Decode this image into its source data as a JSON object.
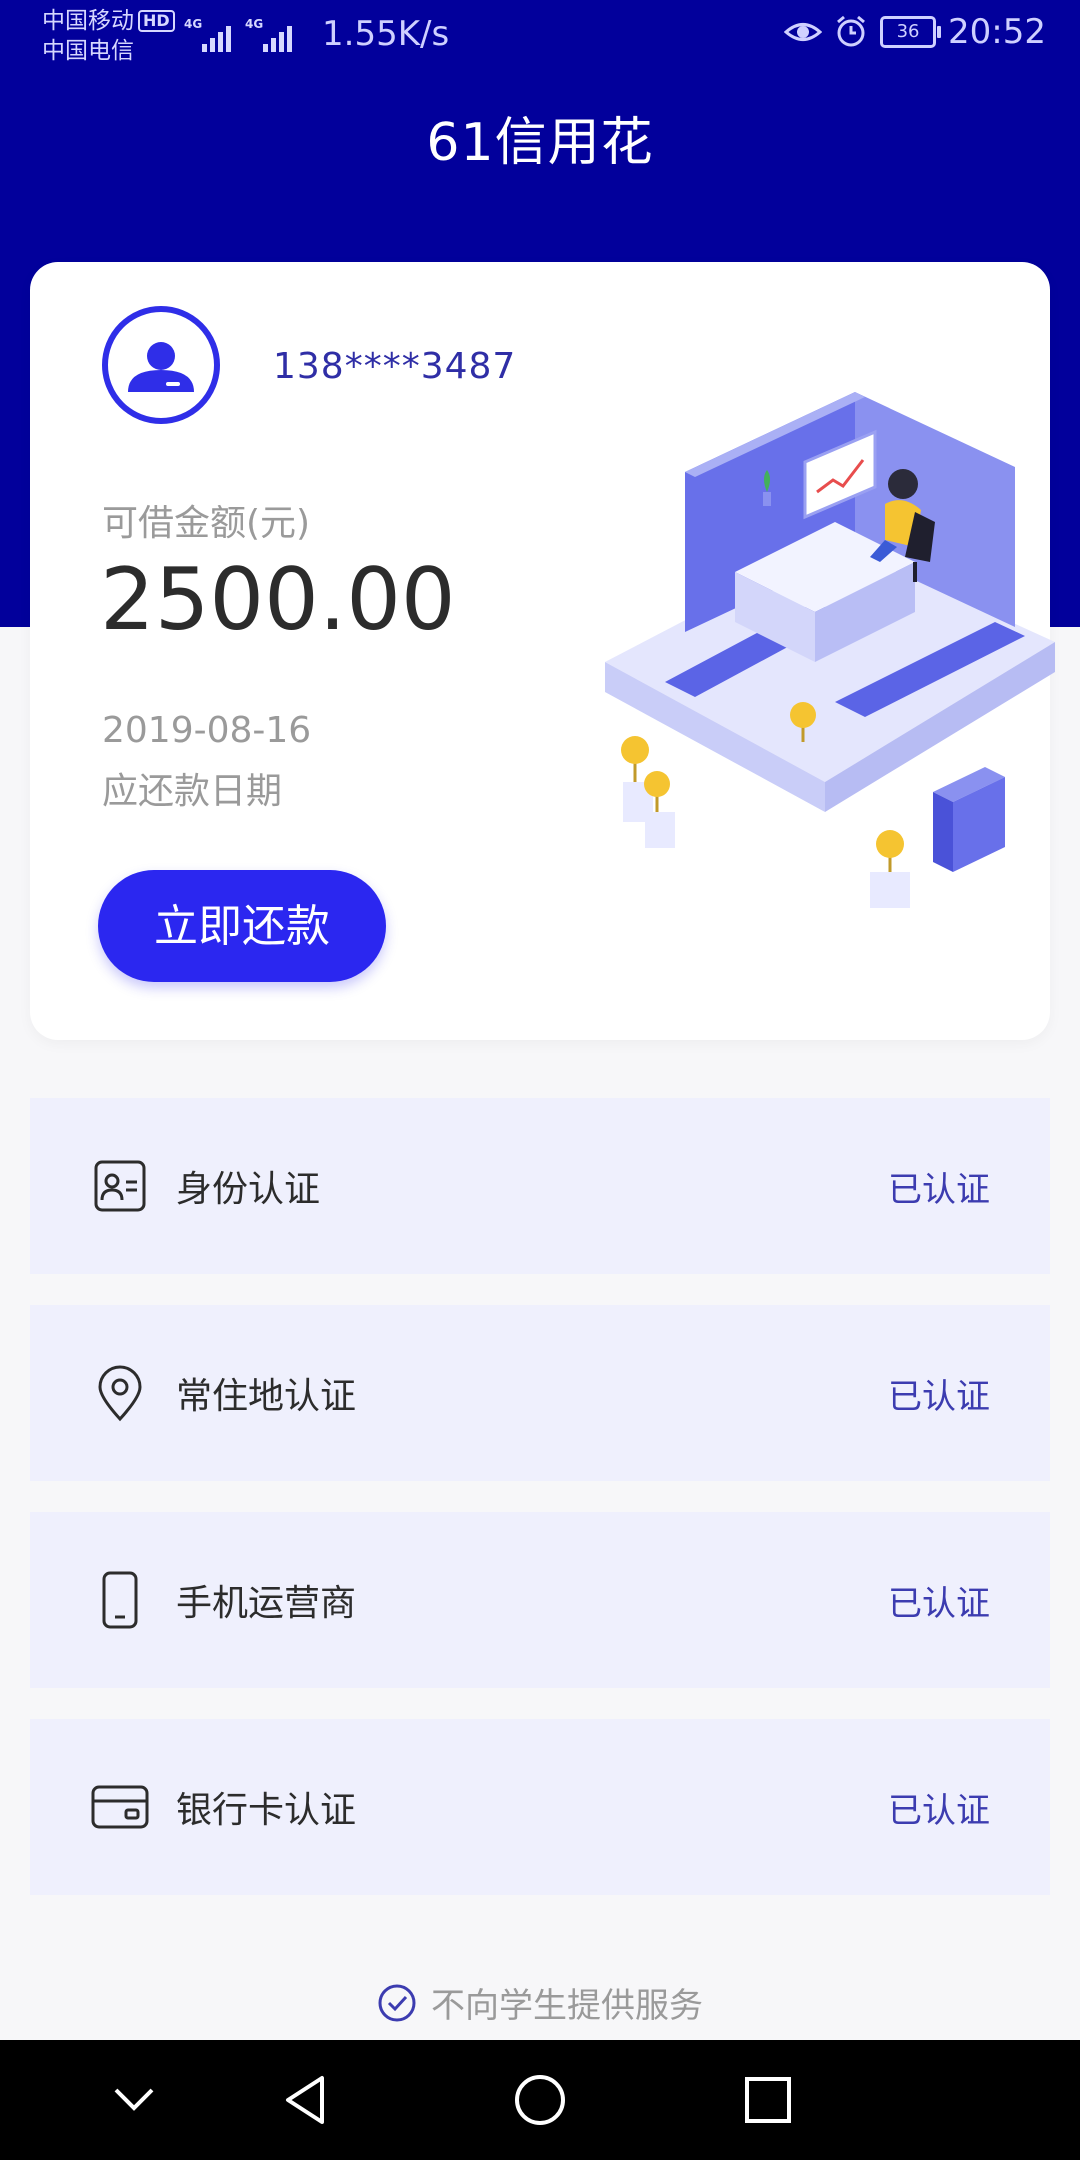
{
  "status_bar": {
    "carrier_1": "中国移动",
    "hd": "HD",
    "carrier_2": "中国电信",
    "network_1": "4G",
    "network_2": "4G",
    "net_speed": "1.55K/s",
    "battery": "36",
    "time": "20:52"
  },
  "header": {
    "title": "61信用花"
  },
  "card": {
    "phone": "138****3487",
    "amount_label": "可借金额(元)",
    "amount": "2500.00",
    "due_date": "2019-08-16",
    "due_label": "应还款日期",
    "repay_button": "立即还款"
  },
  "auth_items": [
    {
      "label": "身份认证",
      "status": "已认证",
      "icon": "id-card-icon"
    },
    {
      "label": "常住地认证",
      "status": "已认证",
      "icon": "location-pin-icon"
    },
    {
      "label": "手机运营商",
      "status": "已认证",
      "icon": "mobile-phone-icon"
    },
    {
      "label": "银行卡认证",
      "status": "已认证",
      "icon": "bank-card-icon"
    }
  ],
  "footer": {
    "note": "不向学生提供服务"
  },
  "colors": {
    "header": "#02009b",
    "accent": "#2b27f0",
    "item_bg": "#eff0fd"
  }
}
